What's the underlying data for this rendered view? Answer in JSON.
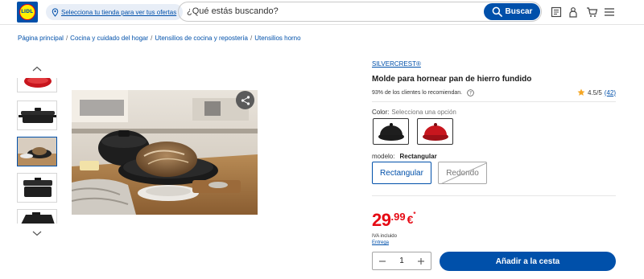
{
  "header": {
    "logo_text": "LIDL",
    "store_selector": "Selecciona tu tienda para ver tus ofertas",
    "search_placeholder": "¿Qué estás buscando?",
    "search_button": "Buscar",
    "icons": [
      "leaflet-icon",
      "user-icon",
      "cart-icon",
      "menu-icon"
    ]
  },
  "breadcrumb": [
    "Página principal",
    "Cocina y cuidado del hogar",
    "Utensilios de cocina y repostería",
    "Utensilios horno"
  ],
  "product": {
    "brand": "SILVERCREST®",
    "title": "Molde para hornear pan de hierro fundido",
    "recommend": "93% de los clientes lo recomiendan.",
    "rating": "4.5/5",
    "rating_count": "(42)",
    "color_label": "Color:",
    "color_prompt": "Selecciona una opción",
    "colors": [
      {
        "name": "negro",
        "hex": "#1e1e1e"
      },
      {
        "name": "rojo",
        "hex": "#c8161e"
      }
    ],
    "model_label": "modelo:",
    "model_selected": "Rectangular",
    "models": [
      "Rectangular",
      "Redondo"
    ],
    "price_int": "29",
    "price_dec": ".99",
    "price_currency": "€",
    "price_mark": "*",
    "price_color": "#e60a14",
    "iva": "IVA incluido",
    "delivery": "Entrega",
    "quantity": "1",
    "add_to_cart": "Añadir a la cesta"
  },
  "colors": {
    "brand_blue": "#0050aa",
    "brand_yellow": "#fff000",
    "price_red": "#e60a14"
  }
}
